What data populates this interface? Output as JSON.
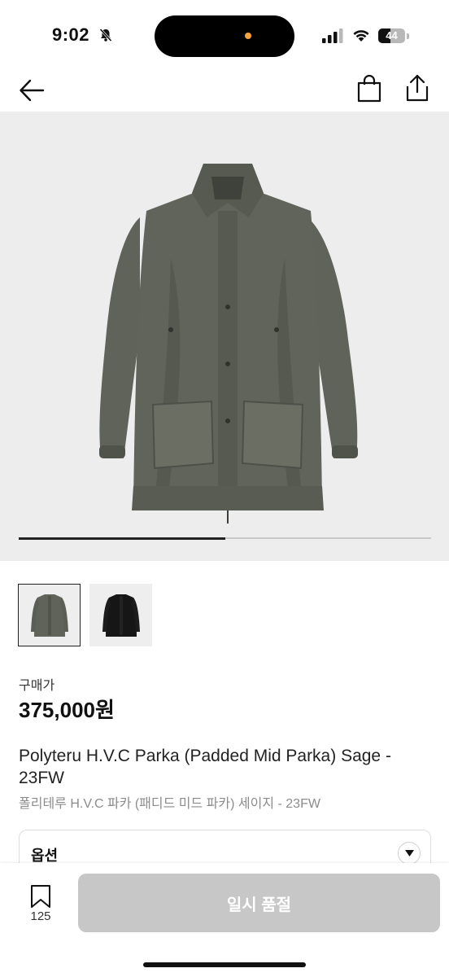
{
  "status_bar": {
    "time": "9:02",
    "battery": "44",
    "battery_level": 0.44
  },
  "nav": {
    "back_icon": "arrow-left-icon",
    "bag_icon": "shopping-bag-icon",
    "share_icon": "share-icon"
  },
  "gallery": {
    "current_image": 1,
    "total_images": 2,
    "thumbnails": [
      {
        "name": "sage-parka",
        "color": "#5f6359",
        "selected": true
      },
      {
        "name": "black-parka",
        "color": "#161616",
        "selected": false
      }
    ]
  },
  "product": {
    "price_label": "구매가",
    "price": "375,000원",
    "title_en": "Polyteru H.V.C Parka (Padded Mid Parka) Sage - 23FW",
    "title_ko": "폴리테루 H.V.C 파카 (패디드 미드 파카) 세이지 - 23FW"
  },
  "option": {
    "label": "옵션"
  },
  "bottom": {
    "bookmark_count": "125",
    "action_label": "일시 품절"
  },
  "colors": {
    "hero_bg": "#ededed",
    "disabled_button": "#c7c7c7",
    "parka": "#5f6359"
  }
}
